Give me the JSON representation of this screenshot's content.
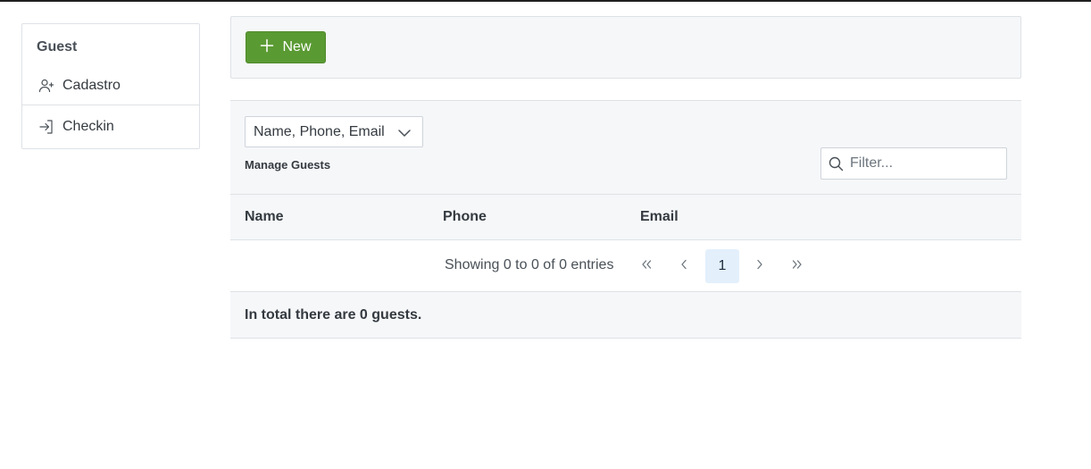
{
  "sidebar": {
    "group_title": "Guest",
    "items": [
      {
        "label": "Cadastro",
        "icon": "user-plus-icon"
      },
      {
        "label": "Checkin",
        "icon": "sign-in-icon"
      }
    ]
  },
  "toolbar": {
    "new_label": "New",
    "new_icon": "plus-icon",
    "new_color": "#5a9a33"
  },
  "table": {
    "columns_selector_value": "Name, Phone, Email",
    "title": "Manage Guests",
    "filter_placeholder": "Filter...",
    "headers": [
      "Name",
      "Phone",
      "Email"
    ],
    "rows": []
  },
  "paginator": {
    "info": "Showing 0 to 0 of 0 entries",
    "current_page": "1",
    "active_page_bg": "#e3f0fc"
  },
  "footer": {
    "summary": "In total there are 0 guests."
  }
}
